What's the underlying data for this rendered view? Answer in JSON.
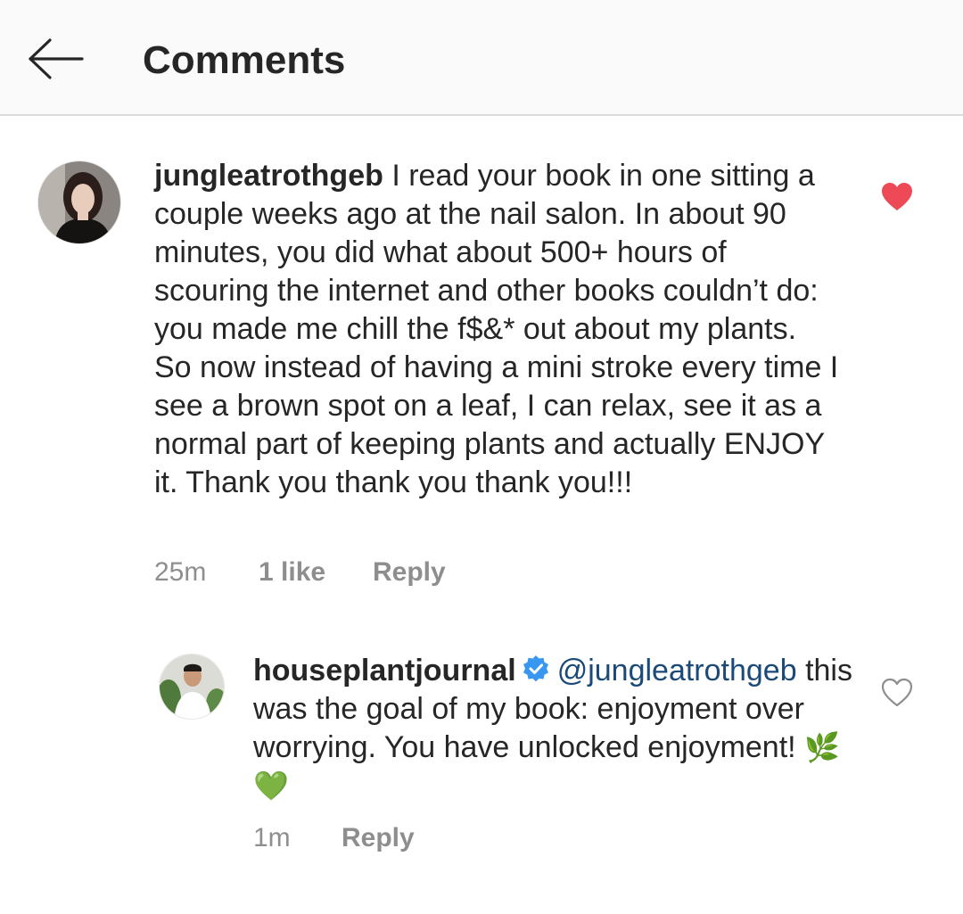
{
  "header": {
    "title": "Comments",
    "back_icon": "arrow-left-icon"
  },
  "comments": [
    {
      "username": "jungleatrothgeb",
      "text": "I read your book in one sitting a couple weeks ago at the nail salon. In about 90 minutes, you did what about 500+ hours of scouring the internet and other books couldn’t do: you made me chill the f$&* out about my plants. So now instead of having a mini stroke every time I see a brown spot on a leaf, I can relax, see it as a normal part of keeping plants and actually ENJOY it. Thank you thank you thank you!!!",
      "time": "25m",
      "likes": "1 like",
      "reply_label": "Reply",
      "liked": true,
      "like_color": "#ed4956"
    }
  ],
  "reply": {
    "username": "houseplantjournal",
    "verified": true,
    "verified_color": "#3897f0",
    "mention": "@jungleatrothgeb",
    "text": "this was the goal of my book: enjoyment over worrying. You have unlocked enjoyment!",
    "emojis": [
      "🌿",
      "💚"
    ],
    "time": "1m",
    "reply_label": "Reply",
    "liked": false
  }
}
